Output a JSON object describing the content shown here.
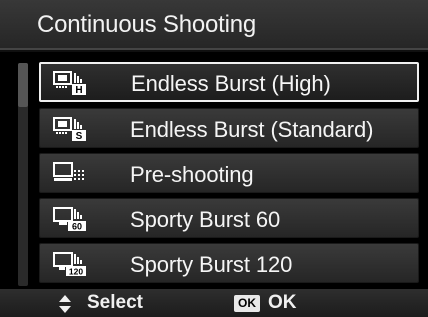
{
  "header": {
    "title": "Continuous Shooting"
  },
  "menu": {
    "selected_index": 0,
    "items": [
      {
        "label": "Endless Burst (High)",
        "icon": "burst-high-icon",
        "badge": "H"
      },
      {
        "label": "Endless Burst (Standard)",
        "icon": "burst-standard-icon",
        "badge": "S"
      },
      {
        "label": "Pre-shooting",
        "icon": "pre-shooting-icon",
        "badge": ""
      },
      {
        "label": "Sporty Burst 60",
        "icon": "sporty-burst-60-icon",
        "badge": "60"
      },
      {
        "label": "Sporty Burst 120",
        "icon": "sporty-burst-120-icon",
        "badge": "120"
      }
    ]
  },
  "footer": {
    "select_label": "Select",
    "ok_badge": "OK",
    "ok_label": "OK"
  },
  "colors": {
    "highlight_border": "#f0f0f0",
    "item_bg": "#333333",
    "background": "#000000"
  }
}
